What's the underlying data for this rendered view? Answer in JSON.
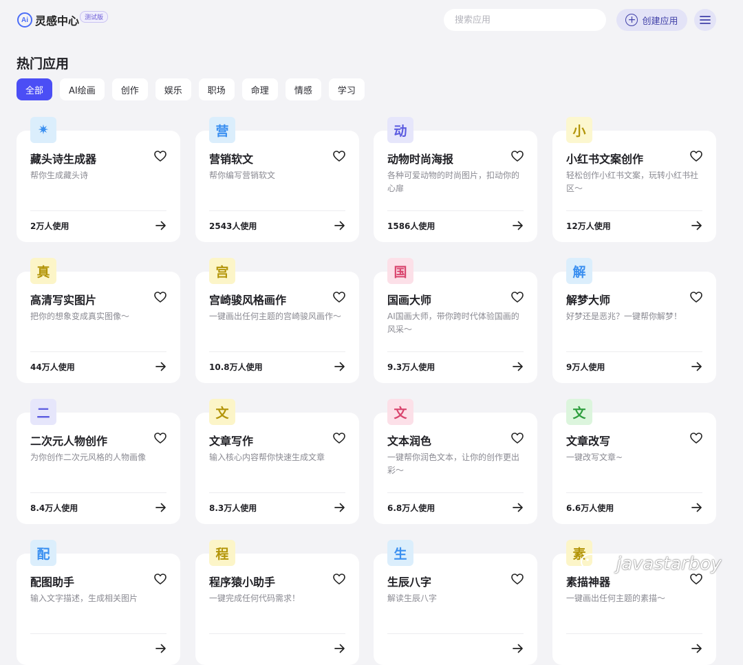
{
  "header": {
    "logo_text": "Ai",
    "title": "灵感中心",
    "beta_badge": "测试版",
    "search_placeholder": "搜索应用",
    "create_label": "创建应用"
  },
  "section_title": "热门应用",
  "tabs": [
    {
      "label": "全部",
      "active": true
    },
    {
      "label": "AI绘画",
      "active": false
    },
    {
      "label": "创作",
      "active": false
    },
    {
      "label": "娱乐",
      "active": false
    },
    {
      "label": "职场",
      "active": false
    },
    {
      "label": "命理",
      "active": false
    },
    {
      "label": "情感",
      "active": false
    },
    {
      "label": "学习",
      "active": false
    }
  ],
  "cards": [
    {
      "icon": "✷",
      "icon_bg": "#dbeefc",
      "icon_color": "#3a8ff0",
      "title": "藏头诗生成器",
      "desc": "帮你生成藏头诗",
      "usage": "2万人使用"
    },
    {
      "icon": "营",
      "icon_bg": "#dbeefc",
      "icon_color": "#3a8ff0",
      "title": "营销软文",
      "desc": "帮你编写营销软文",
      "usage": "2543人使用"
    },
    {
      "icon": "动",
      "icon_bg": "#e6e6fb",
      "icon_color": "#5a5ae0",
      "title": "动物时尚海报",
      "desc": "各种可爱动物的时尚图片，扣动你的心扉",
      "usage": "1586人使用"
    },
    {
      "icon": "小",
      "icon_bg": "#fcf7cf",
      "icon_color": "#b3950a",
      "title": "小红书文案创作",
      "desc": "轻松创作小红书文案，玩转小红书社区～",
      "usage": "12万人使用"
    },
    {
      "icon": "真",
      "icon_bg": "#fcf5c8",
      "icon_color": "#b3950a",
      "title": "高清写实图片",
      "desc": "把你的想象变成真实图像～",
      "usage": "44万人使用"
    },
    {
      "icon": "宫",
      "icon_bg": "#fcf5c8",
      "icon_color": "#b3950a",
      "title": "宫崎骏风格画作",
      "desc": "一键画出任何主题的宫崎骏风画作～",
      "usage": "10.8万人使用"
    },
    {
      "icon": "国",
      "icon_bg": "#fce0e8",
      "icon_color": "#d9456e",
      "title": "国画大师",
      "desc": "AI国画大师，带你跨时代体验国画的风采～",
      "usage": "9.3万人使用"
    },
    {
      "icon": "解",
      "icon_bg": "#dbeefc",
      "icon_color": "#3a8ff0",
      "title": "解梦大师",
      "desc": "好梦还是恶兆？一键帮你解梦！",
      "usage": "9万人使用"
    },
    {
      "icon": "二",
      "icon_bg": "#e6e6fb",
      "icon_color": "#5a5ae0",
      "title": "二次元人物创作",
      "desc": "为你创作二次元风格的人物画像",
      "usage": "8.4万人使用"
    },
    {
      "icon": "文",
      "icon_bg": "#fcf5c8",
      "icon_color": "#b3950a",
      "title": "文章写作",
      "desc": "输入核心内容帮你快速生成文章",
      "usage": "8.3万人使用"
    },
    {
      "icon": "文",
      "icon_bg": "#fce0e8",
      "icon_color": "#d9456e",
      "title": "文本润色",
      "desc": "一键帮你润色文本，让你的创作更出彩～",
      "usage": "6.8万人使用"
    },
    {
      "icon": "文",
      "icon_bg": "#dcf5dd",
      "icon_color": "#2e9e3e",
      "title": "文章改写",
      "desc": "一键改写文章~",
      "usage": "6.6万人使用"
    },
    {
      "icon": "配",
      "icon_bg": "#dbeefc",
      "icon_color": "#3a8ff0",
      "title": "配图助手",
      "desc": "输入文字描述，生成相关图片",
      "usage": ""
    },
    {
      "icon": "程",
      "icon_bg": "#fcf5c8",
      "icon_color": "#b3950a",
      "title": "程序猿小助手",
      "desc": "一键完成任何代码需求！",
      "usage": ""
    },
    {
      "icon": "生",
      "icon_bg": "#dbeefc",
      "icon_color": "#3a8ff0",
      "title": "生辰八字",
      "desc": "解读生辰八字",
      "usage": ""
    },
    {
      "icon": "素",
      "icon_bg": "#fcf5c8",
      "icon_color": "#b3950a",
      "title": "素描神器",
      "desc": "一键画出任何主题的素描～",
      "usage": ""
    }
  ],
  "watermark": "javastarboy"
}
